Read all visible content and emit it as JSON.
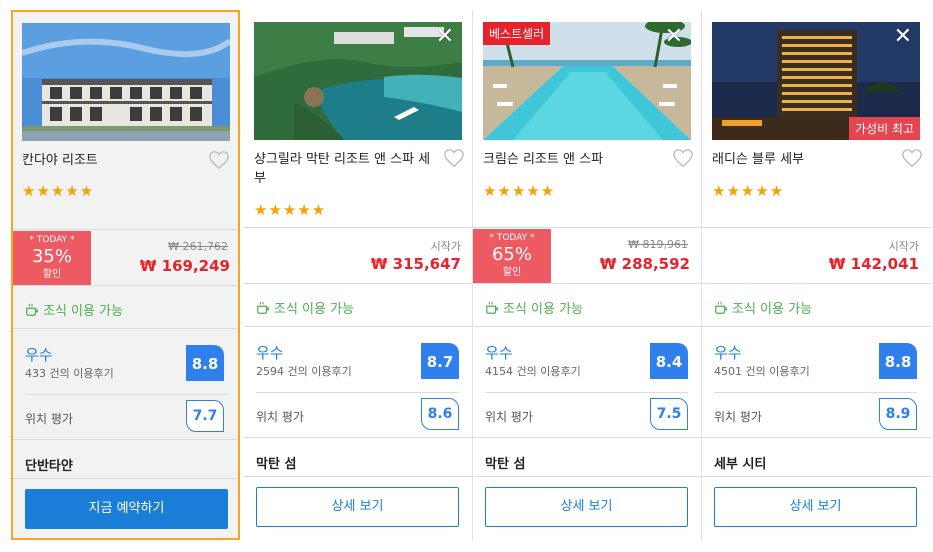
{
  "hotels": [
    {
      "name": "칸다야 리조트",
      "stars": "★★★★★",
      "today_label": "* TODAY *",
      "discount": "35%",
      "discount_suffix": "할인",
      "old_price": "₩ 261,762",
      "price": "₩ 169,249",
      "breakfast": "조식 이용 가능",
      "rating_word": "우수",
      "review_count": "433 건의 이용후기",
      "score": "8.8",
      "location_label": "위치 평가",
      "location_score": "7.7",
      "area": "단반타얀",
      "button": "지금 예약하기"
    },
    {
      "name": "샹그릴라 막탄 리조트 앤 스파 세부",
      "stars": "★★★★★",
      "start_label": "시작가",
      "price": "₩ 315,647",
      "breakfast": "조식 이용 가능",
      "rating_word": "우수",
      "review_count": "2594 건의 이용후기",
      "score": "8.7",
      "location_label": "위치 평가",
      "location_score": "8.6",
      "area": "막탄 섬",
      "button": "상세 보기",
      "close": "✕"
    },
    {
      "name": "크림슨 리조트 앤 스파",
      "stars": "★★★★★",
      "badge": "베스트셀러",
      "today_label": "* TODAY *",
      "discount": "65%",
      "discount_suffix": "할인",
      "old_price": "₩ 819,961",
      "price": "₩ 288,592",
      "breakfast": "조식 이용 가능",
      "rating_word": "우수",
      "review_count": "4154 건의 이용후기",
      "score": "8.4",
      "location_label": "위치 평가",
      "location_score": "7.5",
      "area": "막탄 섬",
      "button": "상세 보기",
      "close": "✕"
    },
    {
      "name": "래디슨 블루 세부",
      "stars": "★★★★★",
      "badge": "가성비 최고",
      "start_label": "시작가",
      "price": "₩ 142,041",
      "breakfast": "조식 이용 가능",
      "rating_word": "우수",
      "review_count": "4501 건의 이용후기",
      "score": "8.8",
      "location_label": "위치 평가",
      "location_score": "8.9",
      "area": "세부 시티",
      "button": "상세 보기",
      "close": "✕"
    }
  ],
  "colors": {
    "selected_border": "#f5a623",
    "price_red": "#e4232c",
    "score_blue": "#2f80ed",
    "breakfast_green": "#4caf50",
    "star_orange": "#f5a100"
  }
}
